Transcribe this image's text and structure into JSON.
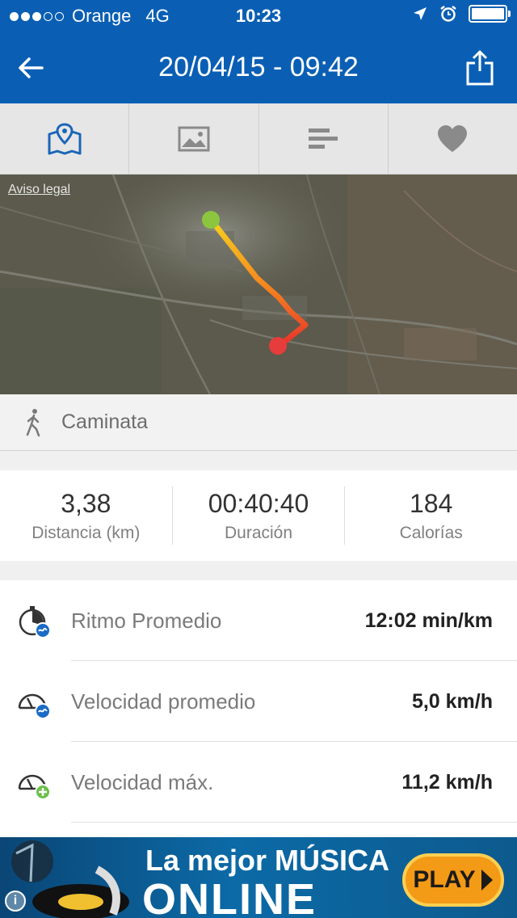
{
  "status_bar": {
    "signal_dots": 3,
    "carrier": "Orange",
    "network": "4G",
    "time": "10:23"
  },
  "header": {
    "title": "20/04/15 - 09:42"
  },
  "tabs": [
    {
      "name": "map",
      "icon": "map-pin-icon",
      "active": true
    },
    {
      "name": "photos",
      "icon": "image-icon",
      "active": false
    },
    {
      "name": "laps",
      "icon": "bars-icon",
      "active": false
    },
    {
      "name": "heart-rate",
      "icon": "heart-icon",
      "active": false
    }
  ],
  "map": {
    "legal_link": "Aviso legal"
  },
  "activity": {
    "type": "Caminata",
    "icon": "walking-icon"
  },
  "stats": [
    {
      "value": "3,38",
      "label": "Distancia (km)"
    },
    {
      "value": "00:40:40",
      "label": "Duración"
    },
    {
      "value": "184",
      "label": "Calorías"
    }
  ],
  "metrics": [
    {
      "name": "Ritmo Promedio",
      "value": "12:02 min/km",
      "icon": "stopwatch-average-icon"
    },
    {
      "name": "Velocidad promedio",
      "value": "5,0 km/h",
      "icon": "speedometer-average-icon"
    },
    {
      "name": "Velocidad máx.",
      "value": "11,2 km/h",
      "icon": "speedometer-max-icon"
    }
  ],
  "ad": {
    "line1": "La mejor MÚSICA",
    "line2": "ONLINE",
    "button": "PLAY"
  },
  "colors": {
    "header_blue": "#0a5fb4",
    "active_tab": "#1a66b8",
    "route_start": "#8cc63f",
    "route_end": "#e63c3c",
    "accent_green": "#6cc04a",
    "accent_blue": "#1a6cc6"
  }
}
